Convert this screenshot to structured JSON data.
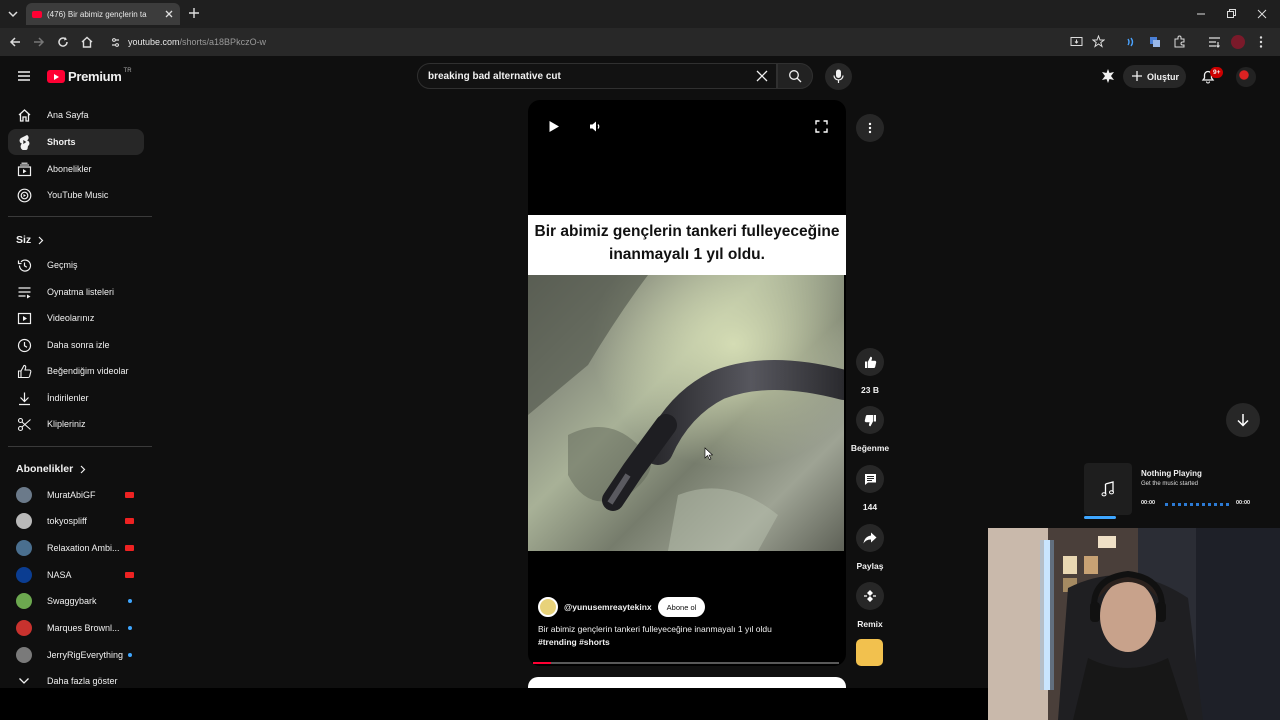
{
  "browser": {
    "tab_title": "(476) Bir abimiz gençlerin ta",
    "url_domain": "youtube.com",
    "url_path": "/shorts/a18BPkczO-w"
  },
  "header": {
    "logo_text": "Premium",
    "country_code": "TR",
    "search_value": "breaking bad alternative cut",
    "create_label": "Oluştur",
    "notifications_badge": "9+"
  },
  "sidebar": {
    "main": [
      {
        "label": "Ana Sayfa",
        "icon": "home-icon"
      },
      {
        "label": "Shorts",
        "icon": "shorts-icon",
        "active": true
      },
      {
        "label": "Abonelikler",
        "icon": "subscriptions-icon"
      },
      {
        "label": "YouTube Music",
        "icon": "music-icon"
      }
    ],
    "you_title": "Siz",
    "you": [
      {
        "label": "Geçmiş",
        "icon": "history-icon"
      },
      {
        "label": "Oynatma listeleri",
        "icon": "playlists-icon"
      },
      {
        "label": "Videolarınız",
        "icon": "your-videos-icon"
      },
      {
        "label": "Daha sonra izle",
        "icon": "watch-later-icon"
      },
      {
        "label": "Beğendiğim videolar",
        "icon": "liked-icon"
      },
      {
        "label": "İndirilenler",
        "icon": "download-icon"
      },
      {
        "label": "Klipleriniz",
        "icon": "clips-icon"
      }
    ],
    "subs_title": "Abonelikler",
    "subs": [
      {
        "label": "MuratAbiGF",
        "color": "#6b7a8a",
        "status": "live"
      },
      {
        "label": "tokyospliff",
        "color": "#b9b9b9",
        "status": "live"
      },
      {
        "label": "Relaxation Ambi...",
        "color": "#4a6f8f",
        "status": "live"
      },
      {
        "label": "NASA",
        "color": "#0b3d91",
        "status": "live"
      },
      {
        "label": "Swaggybark",
        "color": "#6ca84f",
        "status": "new"
      },
      {
        "label": "Marques Brownl...",
        "color": "#c8322e",
        "status": "new"
      },
      {
        "label": "JerryRigEverything",
        "color": "#7a7a7a",
        "status": "new"
      }
    ],
    "show_more": "Daha fazla göster"
  },
  "short": {
    "caption": "Bir abimiz gençlerin tankeri fulleyeceğine inanmayalı 1 yıl oldu.",
    "channel": "@yunusemreaytekinx",
    "subscribe_label": "Abone ol",
    "description": "Bir abimiz gençlerin tankeri fulleyeceğine inanmayalı 1 yıl oldu",
    "hashtags": "#trending #shorts",
    "progress": 0.06
  },
  "actions": {
    "like_count": "23 B",
    "dislike_label": "Beğenme",
    "comment_count": "144",
    "share_label": "Paylaş",
    "remix_label": "Remix"
  },
  "now_playing": {
    "title": "Nothing Playing",
    "subtitle": "Get the music started",
    "time_start": "00:00",
    "time_end": "00:00"
  },
  "colors": {
    "accent": "#ff0033",
    "background": "#0f0f0f",
    "link_blue": "#3ea6ff"
  }
}
